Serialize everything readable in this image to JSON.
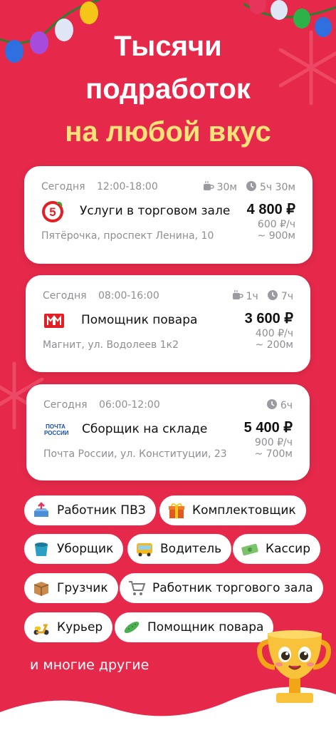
{
  "hero": {
    "line1": "Тысячи",
    "line2": "подработок",
    "line3": "на любой вкус"
  },
  "jobs": [
    {
      "date": "Сегодня",
      "time": "12:00-18:00",
      "break": "30м",
      "duration": "5ч 30м",
      "title": "Услуги в торговом зале",
      "price": "4 800 ₽",
      "rate": "600 ₽/ч",
      "address": "Пятёрочка, проспект Ленина, 10",
      "distance": "~ 900м",
      "logo": "pyaterochka-logo"
    },
    {
      "date": "Сегодня",
      "time": "08:00-16:00",
      "break": "1ч",
      "duration": "7ч",
      "title": "Помощник повара",
      "price": "3 600 ₽",
      "rate": "400 ₽/ч",
      "address": "Магнит, ул. Водолеев 1к2",
      "distance": "~ 200м",
      "logo": "magnit-logo"
    },
    {
      "date": "Сегодня",
      "time": "06:00-12:00",
      "duration": "6ч",
      "title": "Сборщик на складе",
      "price": "5 400 ₽",
      "rate": "900 ₽/ч",
      "address": "Почта России, ул. Конституции, 23",
      "distance": "~ 700м",
      "logo": "pochta-logo",
      "logo_text": "ПОЧТА РОССИИ"
    }
  ],
  "categories": [
    {
      "label": "Работник ПВЗ",
      "icon": "parcel-tray-icon"
    },
    {
      "label": "Комплектовщик",
      "icon": "gift-icon"
    },
    {
      "label": "Уборщик",
      "icon": "bucket-icon"
    },
    {
      "label": "Водитель",
      "icon": "bus-icon"
    },
    {
      "label": "Кассир",
      "icon": "money-icon"
    },
    {
      "label": "Грузчик",
      "icon": "box-icon"
    },
    {
      "label": "Работник торгового зала",
      "icon": "cart-icon"
    },
    {
      "label": "Курьер",
      "icon": "scooter-icon"
    },
    {
      "label": "Помощник повара",
      "icon": "cucumber-icon"
    }
  ],
  "footer": "и многие другие",
  "colors": {
    "background": "#e6294b",
    "accent_yellow": "#ffe17a"
  }
}
